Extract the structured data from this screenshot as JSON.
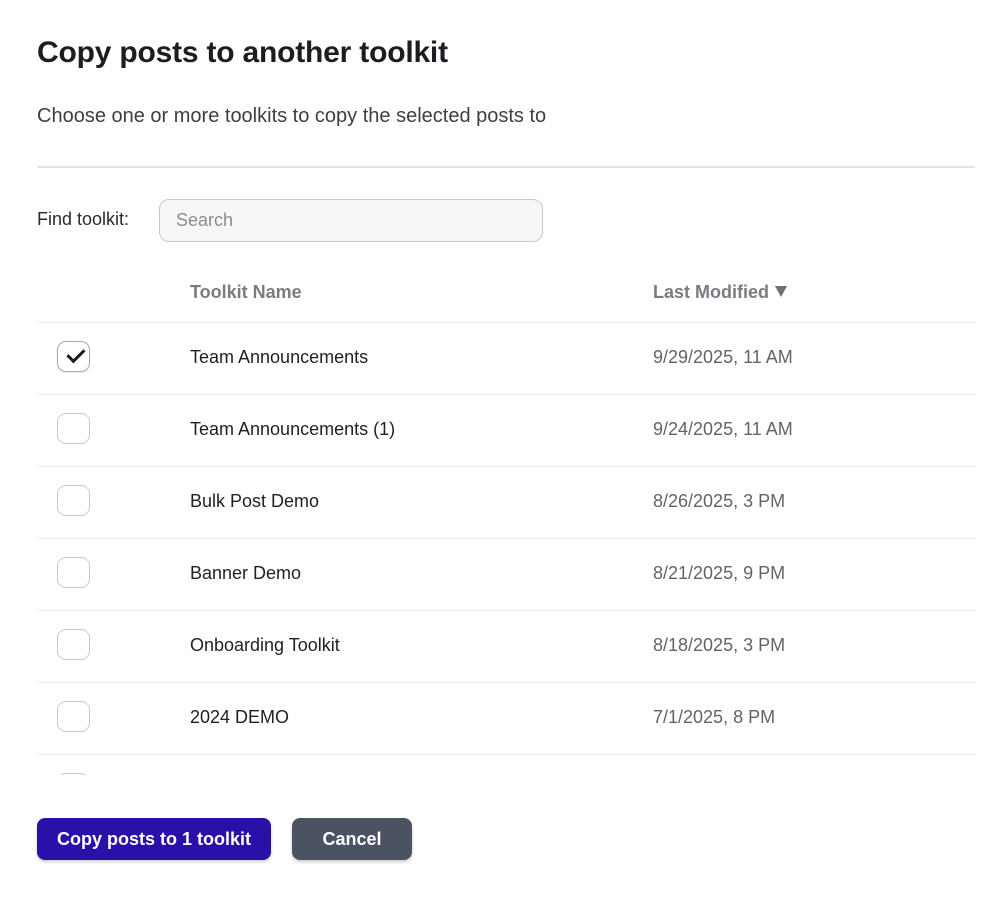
{
  "dialog": {
    "title": "Copy posts to another toolkit",
    "subtitle": "Choose one or more toolkits to copy the selected posts to"
  },
  "search": {
    "label": "Find toolkit:",
    "placeholder": "Search",
    "value": ""
  },
  "table": {
    "columns": {
      "name": "Toolkit Name",
      "modified": "Last Modified"
    },
    "sort": {
      "column": "modified",
      "direction": "descending"
    },
    "rows": [
      {
        "name": "Team Announcements",
        "modified": "9/29/2025, 11 AM",
        "checked": true
      },
      {
        "name": "Team Announcements (1)",
        "modified": "9/24/2025, 11 AM",
        "checked": false
      },
      {
        "name": "Bulk Post Demo",
        "modified": "8/26/2025, 3 PM",
        "checked": false
      },
      {
        "name": "Banner Demo",
        "modified": "8/21/2025, 9 PM",
        "checked": false
      },
      {
        "name": "Onboarding Toolkit",
        "modified": "8/18/2025, 3 PM",
        "checked": false
      },
      {
        "name": "2024 DEMO",
        "modified": "7/1/2025, 8 PM",
        "checked": false
      },
      {
        "name": "",
        "modified": "",
        "checked": false
      }
    ]
  },
  "actions": {
    "primary_label": "Copy posts to 1 toolkit",
    "cancel_label": "Cancel"
  },
  "colors": {
    "primary": "#2a10a8",
    "cancel": "#4b5262"
  }
}
